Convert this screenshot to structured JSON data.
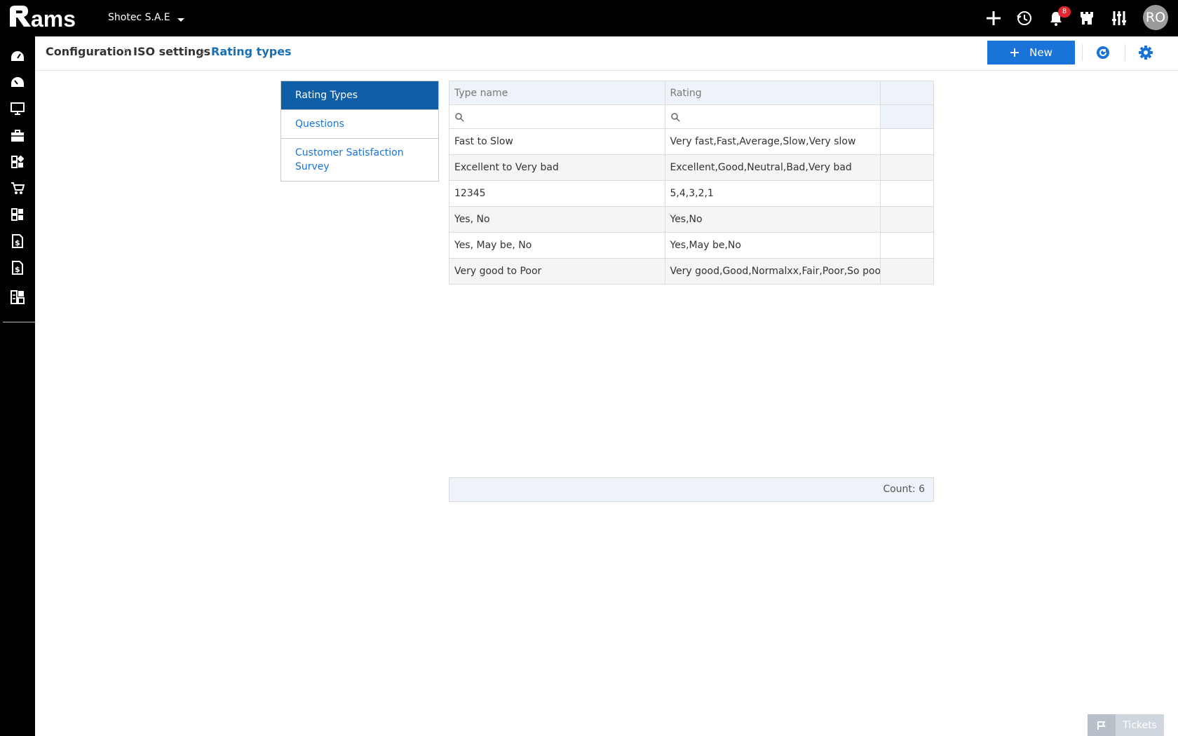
{
  "app": {
    "logo_text": "rams",
    "company": "Shotec S.A.E"
  },
  "topbar": {
    "icons": [
      "plus-icon",
      "history-icon",
      "bell-icon",
      "castle-icon",
      "sliders-icon"
    ],
    "notification_count": "8",
    "avatar_initials": "RO"
  },
  "sidebar": {
    "items": [
      "dashboard-icon",
      "dashboard-alt-icon",
      "monitor-icon",
      "briefcase-icon",
      "widgets-icon",
      "cart-icon",
      "widgets-alt-icon",
      "invoice-icon",
      "invoice-alt-icon",
      "apps-icon"
    ]
  },
  "breadcrumb": [
    "Configuration",
    "ISO settings",
    "Rating types"
  ],
  "toolbar": {
    "new_label": "New"
  },
  "left_menu": [
    {
      "label": "Rating Types",
      "active": true
    },
    {
      "label": "Questions",
      "active": false
    },
    {
      "label": "Customer Satisfaction Survey",
      "active": false
    }
  ],
  "grid": {
    "columns": [
      "Type name",
      "Rating",
      ""
    ],
    "rows": [
      [
        "Fast to Slow",
        "Very fast,Fast,Average,Slow,Very slow"
      ],
      [
        "Excellent to Very bad",
        "Excellent,Good,Neutral,Bad,Very bad"
      ],
      [
        "12345",
        "5,4,3,2,1"
      ],
      [
        "Yes, No",
        "Yes,No"
      ],
      [
        "Yes, May be, No",
        "Yes,May be,No"
      ],
      [
        "Very good to Poor",
        "Very good,Good,Normalxx,Fair,Poor,So poor"
      ]
    ],
    "count_label": "Count: 6"
  },
  "tickets": {
    "label": "Tickets"
  },
  "colors": {
    "primary": "#1a73d9",
    "active_menu": "#0f5ea8",
    "badge": "#e3262f"
  }
}
